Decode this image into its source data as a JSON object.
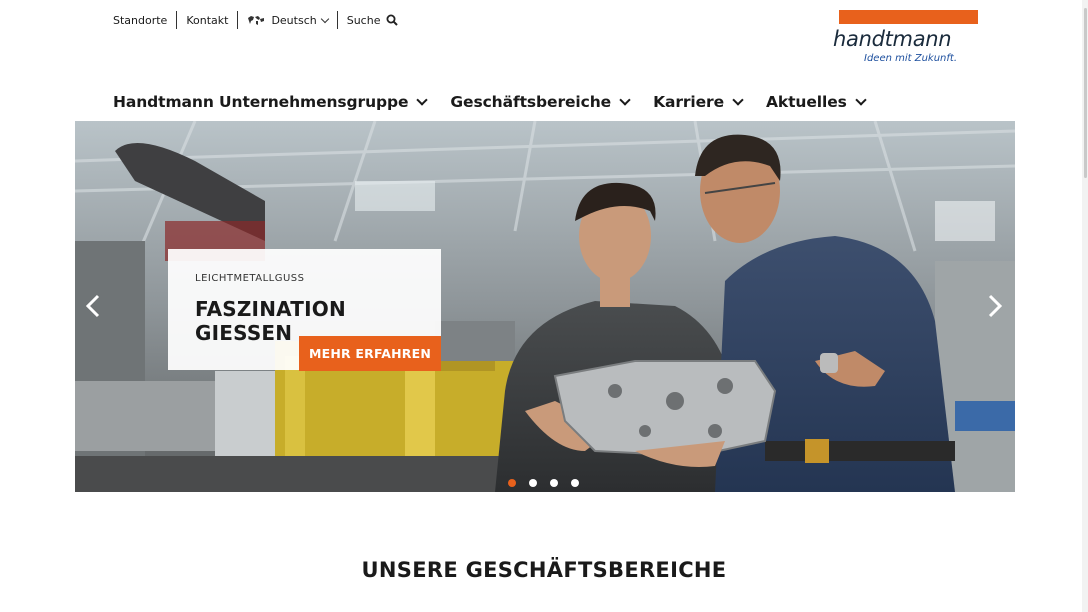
{
  "topbar": {
    "locations": "Standorte",
    "contact": "Kontakt",
    "language": "Deutsch",
    "search": "Suche"
  },
  "logo": {
    "name": "handtmann",
    "tagline": "Ideen mit Zukunft."
  },
  "nav": {
    "items": [
      {
        "label": "Handtmann Unternehmensgruppe"
      },
      {
        "label": "Geschäftsbereiche"
      },
      {
        "label": "Karriere"
      },
      {
        "label": "Aktuelles"
      }
    ]
  },
  "hero": {
    "eyebrow": "LEICHTMETALLGUSS",
    "title": "FASZINATION GIESSEN",
    "cta": "MEHR ERFAHREN",
    "slide_count": 4,
    "active_slide": 1
  },
  "section": {
    "title": "UNSERE GESCHÄFTSBEREICHE"
  },
  "colors": {
    "accent": "#e8611c",
    "brand_blue": "#1d4f9e",
    "text": "#1a1a1a"
  },
  "icons": [
    "globe-icon",
    "chevron-down-icon",
    "search-icon",
    "chevron-left-icon",
    "chevron-right-icon"
  ]
}
